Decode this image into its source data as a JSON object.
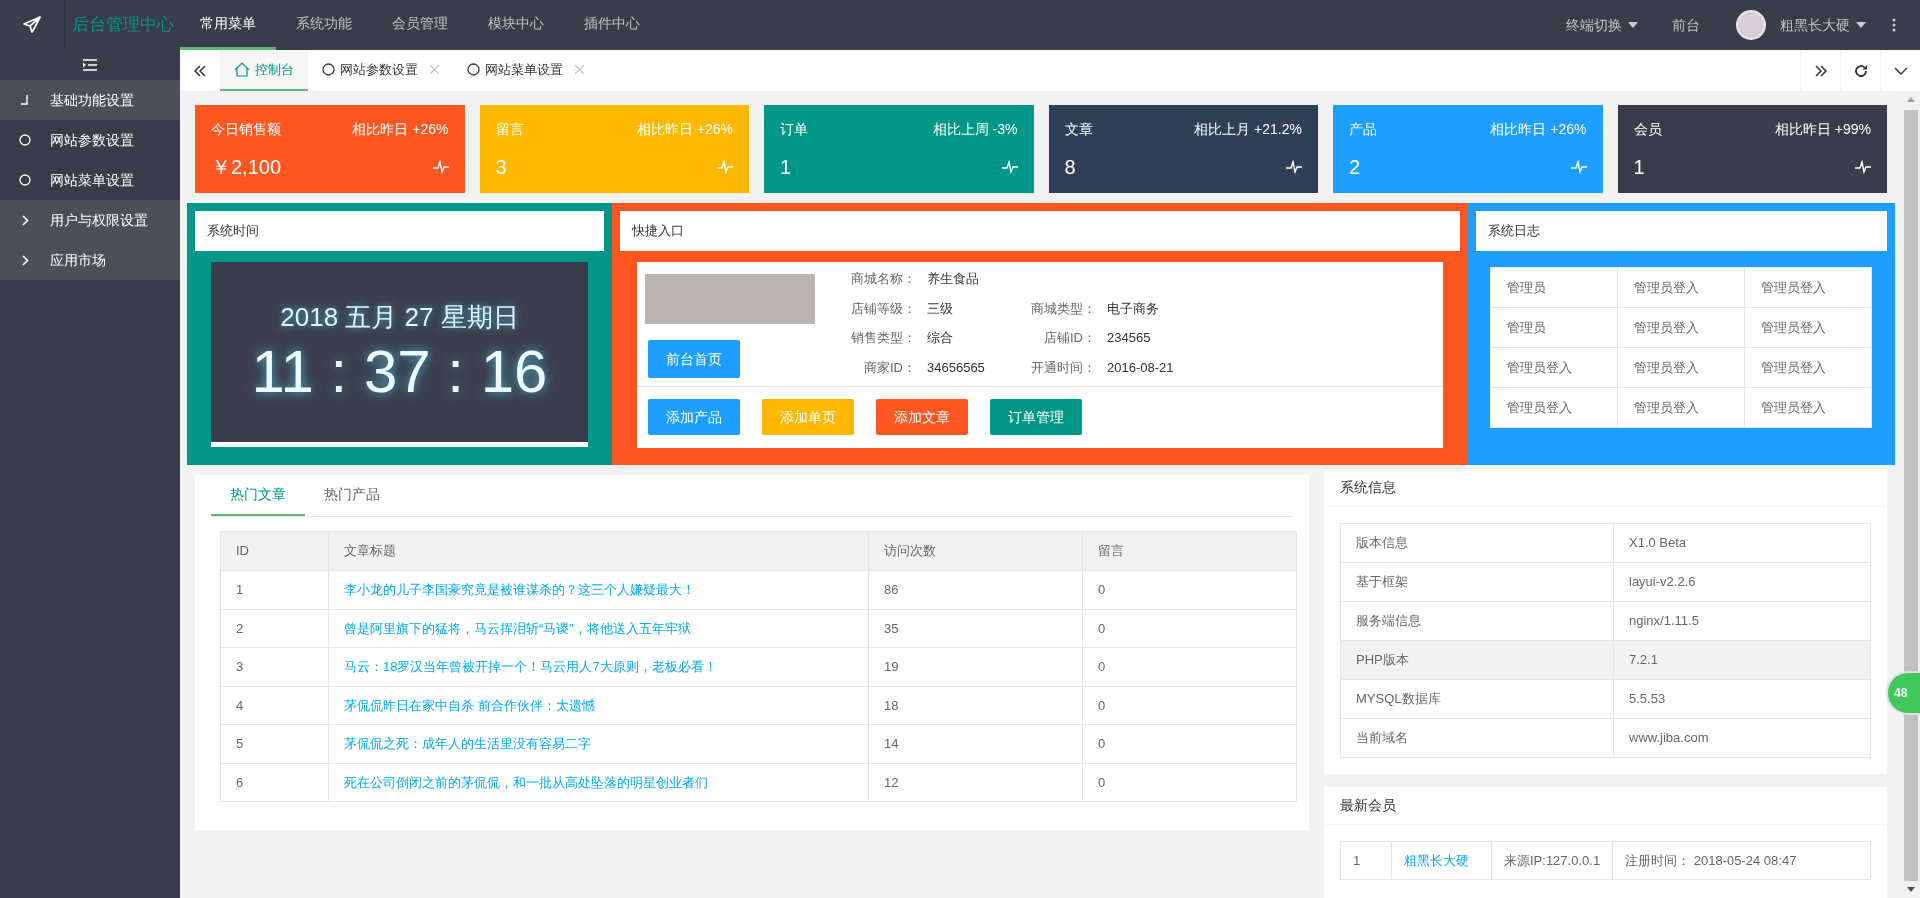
{
  "topbar": {
    "title": "后台管理中心",
    "menu": [
      {
        "label": "常用菜单",
        "selected": true
      },
      {
        "label": "系统功能",
        "selected": false
      },
      {
        "label": "会员管理",
        "selected": false
      },
      {
        "label": "模块中心",
        "selected": false
      },
      {
        "label": "插件中心",
        "selected": false
      }
    ],
    "terminal": "终端切换",
    "frontend": "前台",
    "user": "粗黑长大硬"
  },
  "sidebar": {
    "items": [
      {
        "label": "基础功能设置",
        "expanded": true,
        "children": [
          {
            "label": "网站参数设置"
          },
          {
            "label": "网站菜单设置"
          }
        ]
      },
      {
        "label": "用户与权限设置",
        "expanded": false
      },
      {
        "label": "应用市场",
        "expanded": false
      }
    ]
  },
  "tabs": [
    {
      "label": "控制台",
      "selected": true,
      "kind": "home"
    },
    {
      "label": "网站参数设置",
      "selected": false,
      "kind": "page"
    },
    {
      "label": "网站菜单设置",
      "selected": false,
      "kind": "page"
    }
  ],
  "stats": [
    {
      "label": "今日销售额",
      "compare": "相比昨日 +26%",
      "value": "￥2,100",
      "color": "#ff5722"
    },
    {
      "label": "留言",
      "compare": "相比昨日 +26%",
      "value": "3",
      "color": "#ffb800"
    },
    {
      "label": "订单",
      "compare": "相比上周 -3%",
      "value": "1",
      "color": "#009688"
    },
    {
      "label": "文章",
      "compare": "相比上月 +21.2%",
      "value": "8",
      "color": "#2f4056"
    },
    {
      "label": "产品",
      "compare": "相比昨日 +26%",
      "value": "2",
      "color": "#1e9fff"
    },
    {
      "label": "会员",
      "compare": "相比昨日 +99%",
      "value": "1",
      "color": "#393d49"
    }
  ],
  "system_time": {
    "title": "系统时间",
    "date": "2018 五月 27 星期日",
    "time": "11 : 37 : 16"
  },
  "quick_entry": {
    "title": "快捷入口",
    "home_button": "前台首页",
    "info_rows": [
      [
        {
          "label": "商城名称：",
          "value": "养生食品"
        }
      ],
      [
        {
          "label": "店铺等级：",
          "value": "三级"
        },
        {
          "label": "商城类型：",
          "value": "电子商务"
        }
      ],
      [
        {
          "label": "销售类型：",
          "value": "综合"
        },
        {
          "label": "店铺ID：",
          "value": "234565"
        }
      ],
      [
        {
          "label": "商家ID：",
          "value": "34656565"
        },
        {
          "label": "开通时间：",
          "value": "2016-08-21"
        }
      ]
    ],
    "buttons": [
      {
        "label": "添加产品",
        "color": "#1e9fff"
      },
      {
        "label": "添加单页",
        "color": "#ffb800"
      },
      {
        "label": "添加文章",
        "color": "#ff5722"
      },
      {
        "label": "订单管理",
        "color": "#009688"
      }
    ]
  },
  "system_log": {
    "title": "系统日志",
    "rows": [
      [
        "管理员",
        "管理员登入",
        "管理员登入"
      ],
      [
        "管理员",
        "管理员登入",
        "管理员登入"
      ],
      [
        "管理员登入",
        "管理员登入",
        "管理员登入"
      ],
      [
        "管理员登入",
        "管理员登入",
        "管理员登入"
      ]
    ]
  },
  "articles": {
    "tabs": [
      {
        "label": "热门文章",
        "selected": true
      },
      {
        "label": "热门产品",
        "selected": false
      }
    ],
    "columns": [
      "ID",
      "文章标题",
      "访问次数",
      "留言"
    ],
    "rows": [
      {
        "id": "1",
        "title": "李小龙的儿子李国豪究竟是被谁谋杀的？这三个人嫌疑最大！",
        "visits": "86",
        "comments": "0"
      },
      {
        "id": "2",
        "title": "曾是阿里旗下的猛将，马云挥泪斩“马谡”，将他送入五年牢狱",
        "visits": "35",
        "comments": "0"
      },
      {
        "id": "3",
        "title": "马云：18罗汉当年曾被开掉一个！马云用人7大原则，老板必看！",
        "visits": "19",
        "comments": "0"
      },
      {
        "id": "4",
        "title": "茅侃侃昨日在家中自杀 前合作伙伴：太遗憾",
        "visits": "18",
        "comments": "0"
      },
      {
        "id": "5",
        "title": "茅侃侃之死：成年人的生活里没有容易二字",
        "visits": "14",
        "comments": "0"
      },
      {
        "id": "6",
        "title": "死在公司倒闭之前的茅侃侃，和一批从高处坠落的明星创业者们",
        "visits": "12",
        "comments": "0"
      }
    ]
  },
  "system_info": {
    "title": "系统信息",
    "rows": [
      {
        "label": "版本信息",
        "value": "X1.0 Beta",
        "hovered": false
      },
      {
        "label": "基于框架",
        "value": "layui-v2.2.6",
        "hovered": false
      },
      {
        "label": "服务端信息",
        "value": "nginx/1.11.5",
        "hovered": false
      },
      {
        "label": "PHP版本",
        "value": "7.2.1",
        "hovered": true
      },
      {
        "label": "MYSQL数据库",
        "value": "5.5.53",
        "hovered": false
      },
      {
        "label": "当前域名",
        "value": "www.jiba.com",
        "hovered": false
      }
    ]
  },
  "new_members": {
    "title": "最新会员",
    "rows": [
      {
        "index": "1",
        "name": "粗黑长大硬",
        "ip": "来源IP:127.0.0.1",
        "registered": "注册时间： 2018-05-24 08:47"
      }
    ]
  },
  "float_badge": "48"
}
